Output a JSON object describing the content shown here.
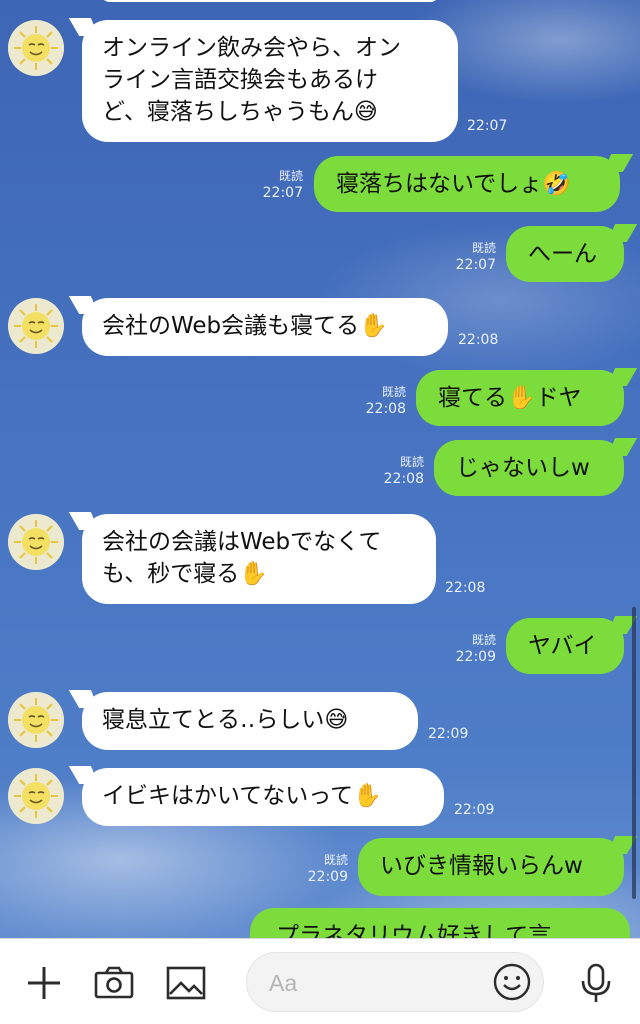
{
  "chat": {
    "messages": [
      {
        "text": "オンライン飲み会やら、オン\nライン言語交換会もあるけ\nど、寝落ちしちゃうもん😅",
        "time": "22:07"
      },
      {
        "text": "寝落ちはないでしょ🤣",
        "time": "22:07",
        "read": "既読"
      },
      {
        "text": "へーん",
        "time": "22:07",
        "read": "既読"
      },
      {
        "text": "会社のWeb会議も寝てる✋",
        "time": "22:08"
      },
      {
        "text": "寝てる✋ドヤ",
        "time": "22:08",
        "read": "既読"
      },
      {
        "text": "じゃないしw",
        "time": "22:08",
        "read": "既読"
      },
      {
        "text": "会社の会議はWebでなくて\nも、秒で寝る✋",
        "time": "22:08"
      },
      {
        "text": "ヤバイ",
        "time": "22:09",
        "read": "既読"
      },
      {
        "text": "寝息立てとる‥らしい😅",
        "time": "22:09"
      },
      {
        "text": "イビキはかいてないって✋",
        "time": "22:09"
      },
      {
        "text": "いびき情報いらんw",
        "time": "22:09",
        "read": "既読"
      },
      {
        "text": "プラネタリウム好きして言"
      }
    ]
  },
  "input": {
    "placeholder": "Aa",
    "icons": [
      "plus-icon",
      "camera-icon",
      "image-icon",
      "smiley-icon",
      "microphone-icon"
    ]
  },
  "colors": {
    "background": "#4672c0",
    "outgoing_bubble": "#7cdc3b",
    "incoming_bubble": "#ffffff",
    "meta_text": "#eaf0ff"
  }
}
